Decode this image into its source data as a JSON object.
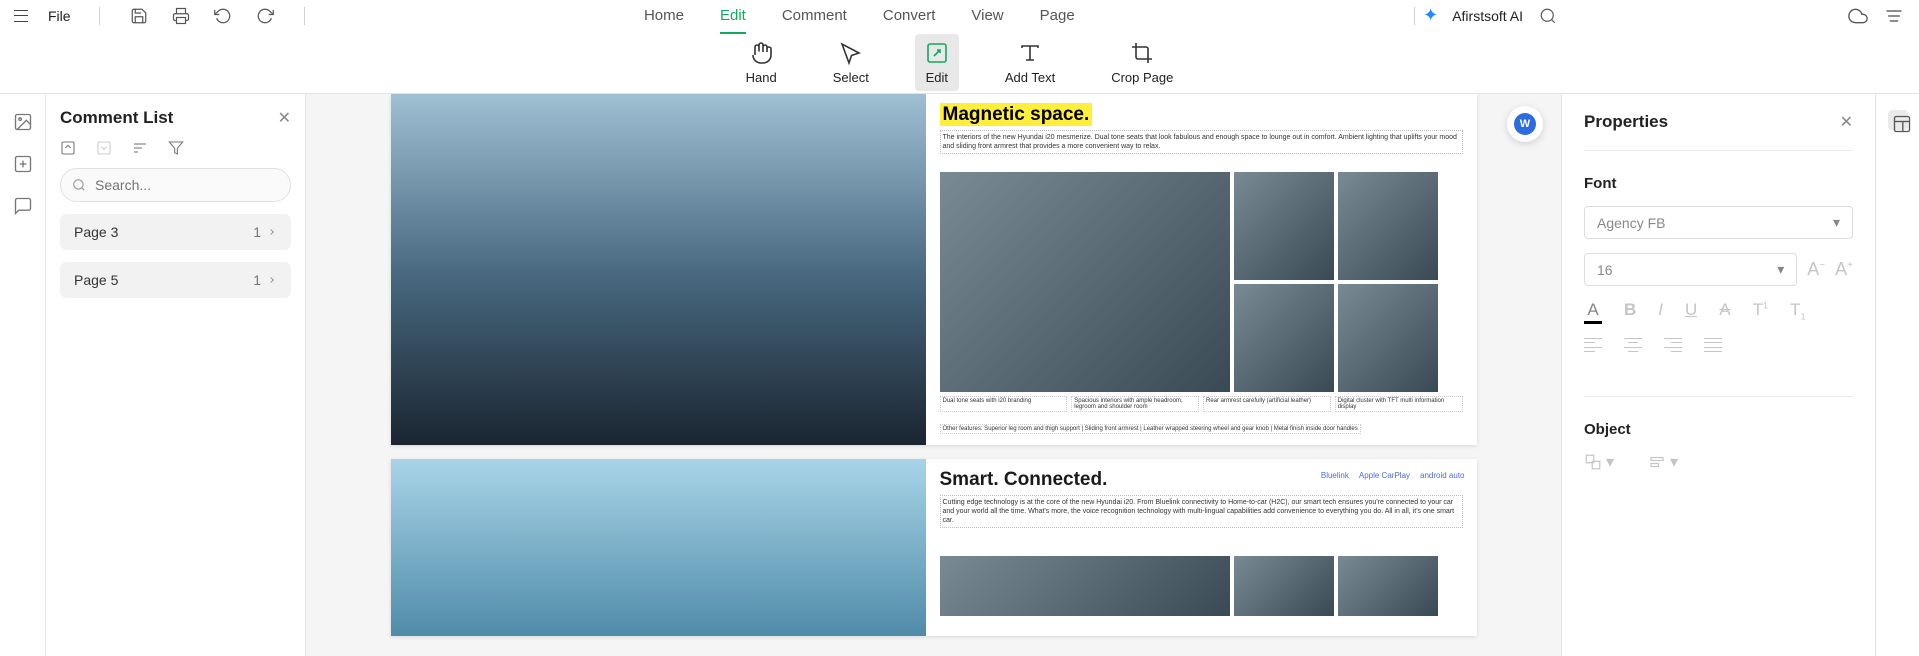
{
  "topbar": {
    "file_label": "File",
    "tabs": [
      "Home",
      "Edit",
      "Comment",
      "Convert",
      "View",
      "Page"
    ],
    "active_tab_index": 1,
    "ai_label": "Afirstsoft AI"
  },
  "toolbar": {
    "tools": [
      {
        "label": "Hand"
      },
      {
        "label": "Select"
      },
      {
        "label": "Edit"
      },
      {
        "label": "Add Text"
      },
      {
        "label": "Crop Page"
      }
    ],
    "active_tool_index": 2
  },
  "comment_panel": {
    "title": "Comment List",
    "search_placeholder": "Search...",
    "pages": [
      {
        "label": "Page 3",
        "count": 1
      },
      {
        "label": "Page 5",
        "count": 1
      }
    ]
  },
  "document": {
    "page_a": {
      "headline": "Magnetic space.",
      "description": "The interiors of the new Hyundai i20 mesmerize. Dual tone seats that look fabulous and enough space to lounge out in comfort. Ambient lighting that uplifts your mood and sliding front armrest that provides a more convenient way to relax.",
      "captions": [
        "Dual tone seats with i20 branding",
        "Spacious interiors with ample headroom, legroom and shoulder room",
        "Rear armrest carefully (artificial leather)",
        "Digital cluster with TFT multi information display"
      ],
      "features": "Other features: Superior leg room and thigh support | Sliding front armrest | Leather wrapped steering wheel and gear knob | Metal finish inside door handles"
    },
    "page_b": {
      "headline": "Smart. Connected.",
      "description": "Cutting edge technology is at the core of the new Hyundai i20. From Bluelink connectivity to Home-to-car (H2C), our smart tech ensures you're connected to your car and your world all the time. What's more, the voice recognition technology with multi-lingual capabilities add convenience to everything you do. All in all, it's one smart car.",
      "logos": [
        "Bluelink",
        "Apple CarPlay",
        "android auto"
      ]
    },
    "translate_badge": "W"
  },
  "properties": {
    "title": "Properties",
    "font_section": "Font",
    "font_family": "Agency FB",
    "font_size": "16",
    "object_section": "Object"
  }
}
